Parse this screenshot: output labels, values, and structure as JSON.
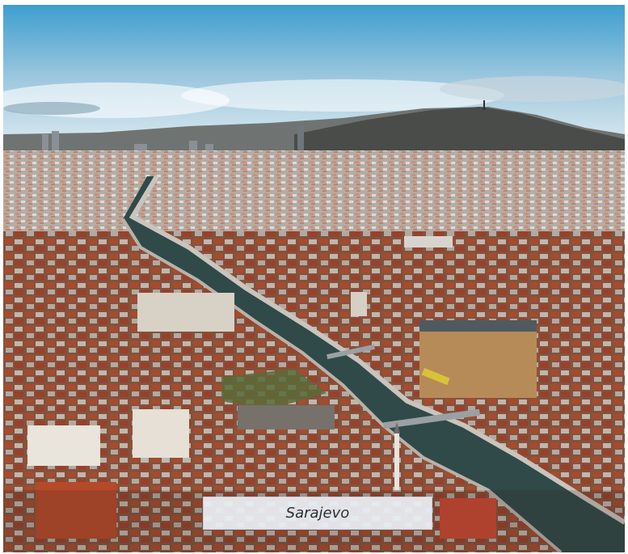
{
  "photo": {
    "subject": "aerial-city-view",
    "colors": {
      "sky_top": "#3d9ed0",
      "sky_bottom": "#eef3f5",
      "hill": "#4a4c4a",
      "roof": "#b8502e",
      "river": "#2f4a48"
    }
  },
  "caption": {
    "text": "Sarajevo"
  }
}
